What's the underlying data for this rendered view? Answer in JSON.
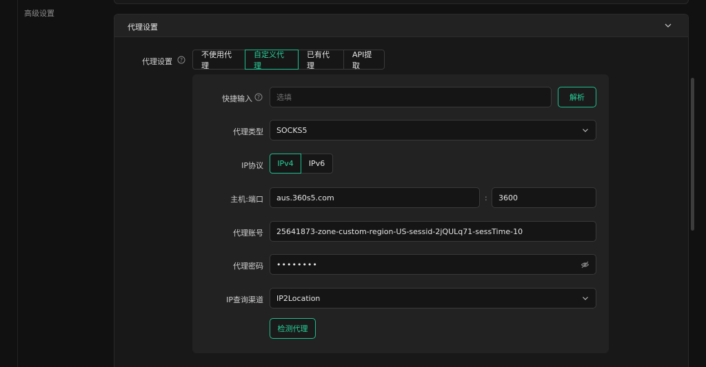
{
  "sidebar": {
    "item_advanced": "高级设置"
  },
  "card": {
    "title": "代理设置"
  },
  "proxy_mode": {
    "label": "代理设置",
    "options": [
      "不使用代理",
      "自定义代理",
      "已有代理",
      "API提取"
    ],
    "selected": "自定义代理"
  },
  "quick_input": {
    "label": "快捷输入",
    "placeholder": "选填",
    "parse_button": "解析"
  },
  "proxy_type": {
    "label": "代理类型",
    "value": "SOCKS5"
  },
  "ip_protocol": {
    "label": "IP协议",
    "options": [
      "IPv4",
      "IPv6"
    ],
    "selected": "IPv4"
  },
  "host_port": {
    "label": "主机:端口",
    "host": "aus.360s5.com",
    "separator": ":",
    "port": "3600"
  },
  "account": {
    "label": "代理账号",
    "value": "25641873-zone-custom-region-US-sessid-2jQULq71-sessTime-10"
  },
  "password": {
    "label": "代理密码",
    "value": "••••••••"
  },
  "ip_channel": {
    "label": "IP查询渠道",
    "value": "IP2Location"
  },
  "check_button": "检测代理",
  "colors": {
    "accent": "#28d19b",
    "background": "#111111",
    "card": "#181818",
    "panel": "#222222"
  },
  "icons": [
    "help-icon",
    "chevron-down-icon",
    "eye-off-icon"
  ]
}
